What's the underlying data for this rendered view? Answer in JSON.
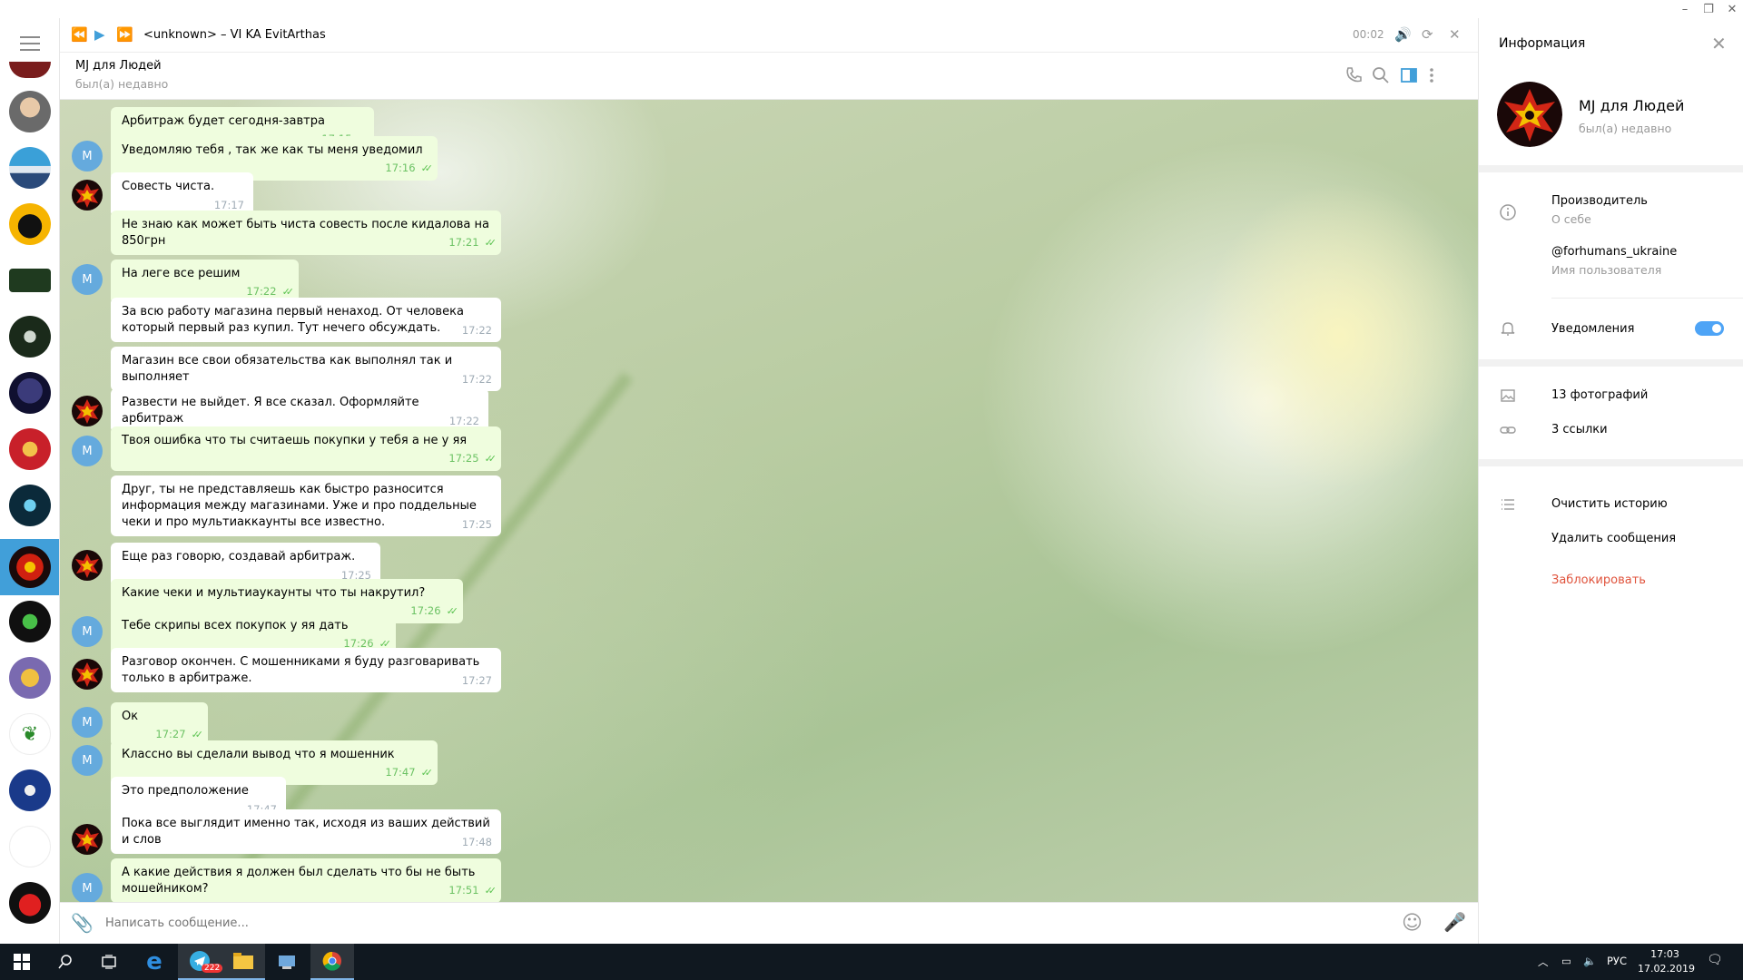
{
  "player": {
    "track_title": "<unknown> – VI KA  EvitArthas",
    "time": "00:02"
  },
  "chat": {
    "title": "MJ для Людей",
    "status": "был(а) недавно",
    "compose_placeholder": "Написать сообщение..."
  },
  "messages": [
    {
      "side": "out",
      "avatar": "",
      "text": "Арбитраж будет сегодня-завтра",
      "time": "17:15"
    },
    {
      "side": "out",
      "avatar": "М",
      "text": "Уведомляю тебя , так же как ты меня уведомил",
      "time": "17:16"
    },
    {
      "side": "in",
      "avatar": "logo",
      "text": "Совесть чиста.",
      "time": "17:17"
    },
    {
      "side": "out",
      "avatar": "",
      "text": "Не знаю как может быть чиста совесть после кидалова на 850грн",
      "time": "17:21"
    },
    {
      "side": "out",
      "avatar": "М",
      "text": "На леге все решим",
      "time": "17:22"
    },
    {
      "side": "in",
      "avatar": "",
      "text": "За всю работу магазина первый ненаход. От человека который первый раз купил. Тут нечего обсуждать.",
      "time": "17:22"
    },
    {
      "side": "in",
      "avatar": "",
      "text": "Магазин все свои обязательства как выполнял так и выполняет",
      "time": "17:22"
    },
    {
      "side": "in",
      "avatar": "logo",
      "text": "Развести не выйдет. Я все сказал. Оформляйте арбитраж",
      "time": "17:22"
    },
    {
      "side": "out",
      "avatar": "М",
      "text": "Твоя ошибка что ты считаешь покупки у тебя а не у яя",
      "time": "17:25"
    },
    {
      "side": "in",
      "avatar": "",
      "text": "Друг, ты не представляешь как быстро разносится информация между магазинами. Уже и про поддельные чеки и про мультиаккаунты все известно.",
      "time": "17:25"
    },
    {
      "side": "in",
      "avatar": "logo",
      "text": "Еще раз говорю, создавай арбитраж.",
      "time": "17:25"
    },
    {
      "side": "out",
      "avatar": "",
      "text": "Какие чеки и мультиаукаунты что ты накрутил?",
      "time": "17:26"
    },
    {
      "side": "out",
      "avatar": "М",
      "text": "Тебе скрипы всех покупок у яя дать",
      "time": "17:26"
    },
    {
      "side": "in",
      "avatar": "logo",
      "text": "Разговор окончен. С мошенниками я буду разговаривать только в арбитраже.",
      "time": "17:27"
    },
    {
      "side": "out",
      "avatar": "М",
      "text": "Ок",
      "time": "17:27"
    },
    {
      "side": "out",
      "avatar": "М",
      "text": "Классно вы сделали вывод что я мошенник",
      "time": "17:47"
    },
    {
      "side": "in",
      "avatar": "",
      "text": "Это предположение",
      "time": "17:47"
    },
    {
      "side": "in",
      "avatar": "logo",
      "text": "Пока все выглядит именно так, исходя из ваших действий и слов",
      "time": "17:48"
    },
    {
      "side": "out",
      "avatar": "М",
      "text": "А какие действия я должен был сделать что бы не быть мошейником?",
      "time": "17:51"
    }
  ],
  "info_panel": {
    "header": "Информация",
    "name": "MJ для Людей",
    "status": "был(а) недавно",
    "bio": "Производитель",
    "bio_label": "О себе",
    "username": "@forhumans_ukraine",
    "username_label": "Имя пользователя",
    "notifications_label": "Уведомления",
    "notifications_on": true,
    "photos": "13 фотографий",
    "links": "3 ссылки",
    "clear_history": "Очистить историю",
    "delete_messages": "Удалить сообщения",
    "block": "Заблокировать"
  },
  "taskbar": {
    "telegram_badge": "222",
    "language": "РУС",
    "time": "17:03",
    "date": "17.02.2019"
  },
  "colors": {
    "accent": "#419fd9",
    "outgoing_bubble": "#effdde",
    "read_ticks": "#5dc452",
    "danger": "#e0533c"
  }
}
